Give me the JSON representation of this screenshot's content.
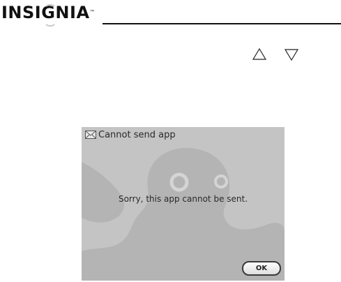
{
  "brand": {
    "logo_text": "INSIGNIA",
    "trademark": "™"
  },
  "nav": {
    "up_icon": "triangle-up-icon",
    "down_icon": "triangle-down-icon"
  },
  "dialog": {
    "title": "Cannot send app",
    "title_icon": "envelope-icon",
    "message": "Sorry, this app cannot be sent.",
    "ok_label": "OK"
  },
  "colors": {
    "screen_background": "#c4c4c4",
    "octopus_watermark": "#b2b2b2",
    "text": "#2a2a2a"
  }
}
